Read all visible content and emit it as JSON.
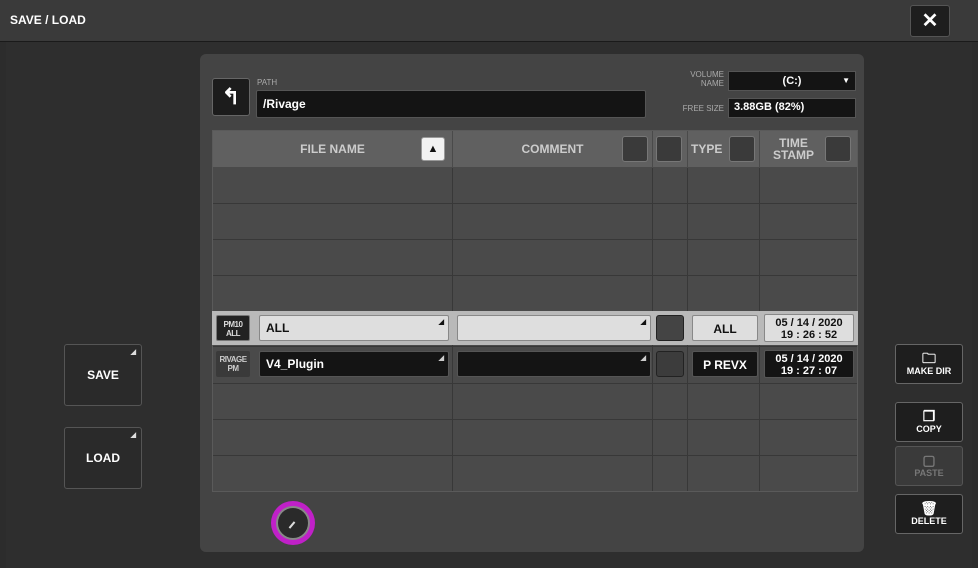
{
  "window": {
    "title": "SAVE / LOAD",
    "close_icon": "close-icon"
  },
  "left_buttons": {
    "save": "SAVE",
    "load": "LOAD"
  },
  "path": {
    "label": "PATH",
    "value": "/Rivage"
  },
  "volume": {
    "label_line1": "VOLUME",
    "label_line2": "NAME",
    "value": "(C:)"
  },
  "free_size": {
    "label": "FREE SIZE",
    "value": "3.88GB (82%)"
  },
  "table": {
    "headers": {
      "file_name": "FILE NAME",
      "comment": "COMMENT",
      "type": "TYPE",
      "time_stamp_line1": "TIME",
      "time_stamp_line2": "STAMP"
    },
    "sort_symbol": "▲",
    "rows": [
      {
        "icon_line1": "PM10",
        "icon_line2": "ALL",
        "name": "ALL",
        "comment": "",
        "type": "ALL",
        "date": "05 / 14 / 2020",
        "time": "19 : 26 : 52",
        "selected": true
      },
      {
        "icon_line1": "RIVAGE",
        "icon_line2": "PM",
        "name": "V4_Plugin",
        "comment": "",
        "type": "P REVX",
        "date": "05 / 14 / 2020",
        "time": "19 : 27 : 07",
        "selected": false
      }
    ]
  },
  "side_buttons": {
    "make_dir": "MAKE DIR",
    "copy": "COPY",
    "paste": "PASTE",
    "delete": "DELETE"
  },
  "colors": {
    "knob_accent": "#c020c8",
    "selected_row": "#b9b9b9"
  }
}
